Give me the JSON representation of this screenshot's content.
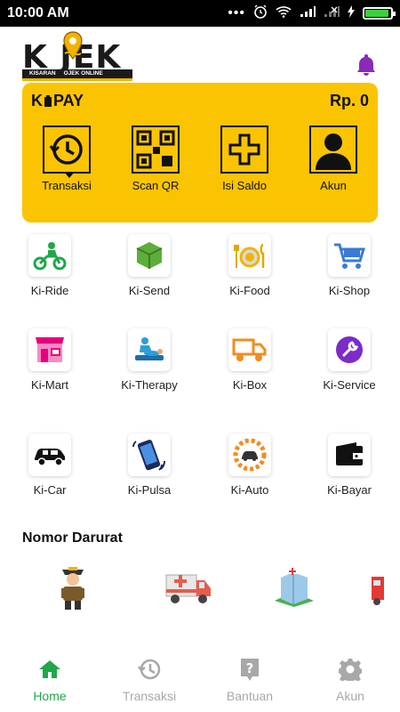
{
  "status_bar": {
    "time": "10:00 AM"
  },
  "header": {
    "logo_letters": "K  JEK",
    "logo_tagline": "KISARAN     OJEK ONLINE",
    "bell_icon": "bell-icon"
  },
  "kpay": {
    "brand": "PAY",
    "balance": "Rp. 0",
    "actions": [
      {
        "label": "Transaksi",
        "icon": "history-icon"
      },
      {
        "label": "Scan QR",
        "icon": "qr-code-icon"
      },
      {
        "label": "Isi Saldo",
        "icon": "plus-icon"
      },
      {
        "label": "Akun",
        "icon": "user-icon"
      }
    ]
  },
  "services": [
    {
      "label": "Ki-Ride",
      "icon": "motorbike-icon"
    },
    {
      "label": "Ki-Send",
      "icon": "package-icon"
    },
    {
      "label": "Ki-Food",
      "icon": "food-icon"
    },
    {
      "label": "Ki-Shop",
      "icon": "shopping-cart-icon"
    },
    {
      "label": "Ki-Mart",
      "icon": "store-icon"
    },
    {
      "label": "Ki-Therapy",
      "icon": "massage-icon"
    },
    {
      "label": "Ki-Box",
      "icon": "truck-icon"
    },
    {
      "label": "Ki-Service",
      "icon": "wrench-icon"
    },
    {
      "label": "Ki-Car",
      "icon": "car-icon"
    },
    {
      "label": "Ki-Pulsa",
      "icon": "phone-icon"
    },
    {
      "label": "Ki-Auto",
      "icon": "auto-service-icon"
    },
    {
      "label": "Ki-Bayar",
      "icon": "wallet-icon"
    }
  ],
  "emergency": {
    "title": "Nomor Darurat",
    "items": [
      "police-icon",
      "ambulance-icon",
      "hospital-icon",
      "fire-truck-icon"
    ]
  },
  "bottom_nav": [
    {
      "label": "Home",
      "icon": "home-icon",
      "active": true
    },
    {
      "label": "Transaksi",
      "icon": "history-icon",
      "active": false
    },
    {
      "label": "Bantuan",
      "icon": "help-icon",
      "active": false
    },
    {
      "label": "Akun",
      "icon": "gear-icon",
      "active": false
    }
  ],
  "colors": {
    "accent": "#fbc402",
    "active_nav": "#1fa84a",
    "inactive_nav": "#a8a8a8",
    "bell": "#8a2ab8"
  }
}
